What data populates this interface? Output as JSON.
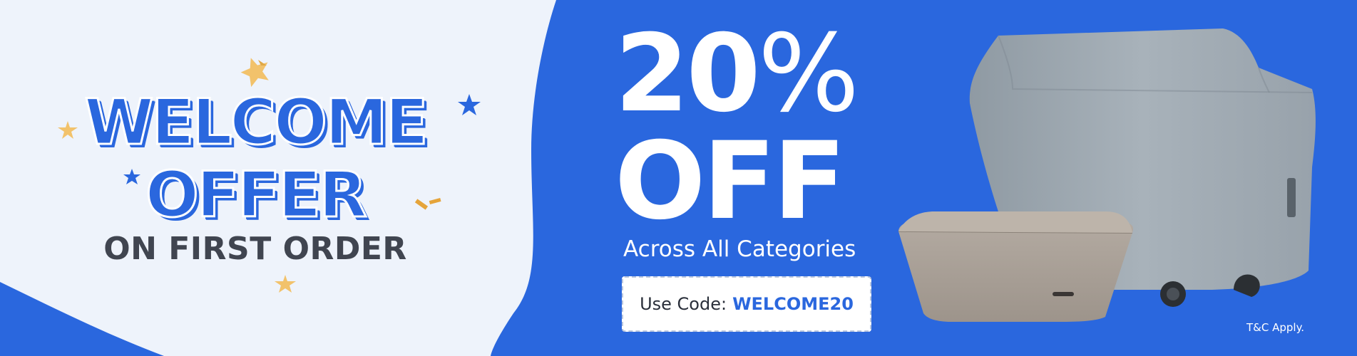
{
  "banner": {
    "headline_line1": "WELCOME",
    "headline_line2": "OFFER",
    "subheadline": "ON FIRST ORDER",
    "discount_value": "20",
    "discount_sign": "%",
    "discount_word": "OFF",
    "scope": "Across All Categories",
    "code_label": "Use Code:",
    "code_value": "WELCOME20",
    "terms": "T&C Apply."
  },
  "colors": {
    "brand_blue": "#2a67de",
    "light_panel": "#eef3fb",
    "star_gold": "#f2c26b",
    "text_dark": "#404550"
  },
  "icons": [
    "star-icon",
    "confetti-icon",
    "grill-cover-image",
    "fire-pit-cover-image"
  ]
}
